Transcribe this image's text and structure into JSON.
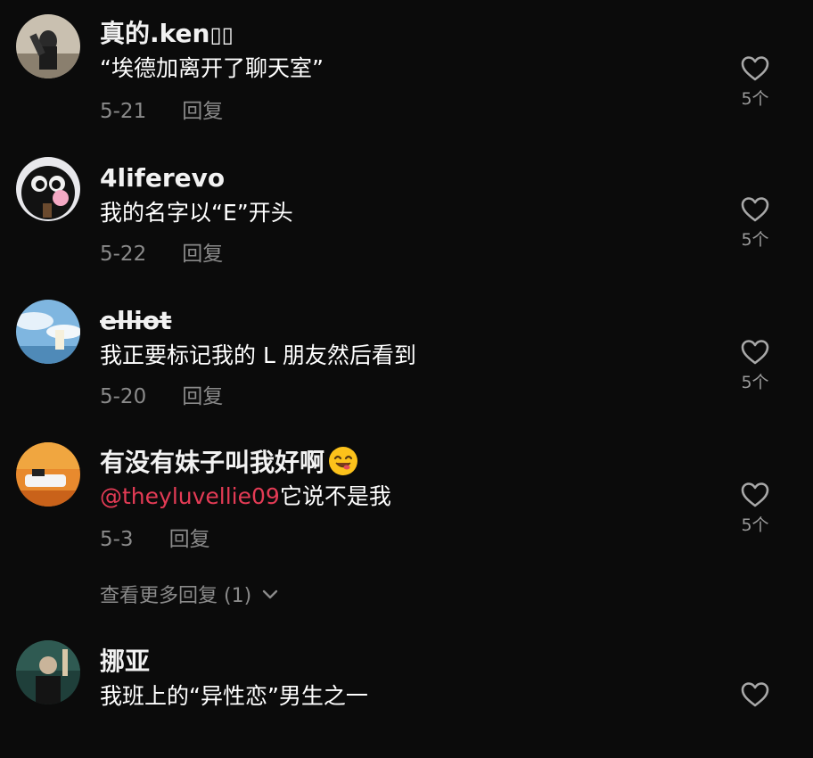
{
  "comments": [
    {
      "username": "真的.ken",
      "username_suffix": "▯▯",
      "text": "“埃德加离开了聊天室”",
      "date": "5-21",
      "reply_label": "回复",
      "likes": "5个"
    },
    {
      "username": "4liferevo",
      "text": "我的名字以“E”开头",
      "date": "5-22",
      "reply_label": "回复",
      "likes": "5个"
    },
    {
      "username": "elliot",
      "text": "我正要标记我的 L 朋友然后看到",
      "date": "5-20",
      "reply_label": "回复",
      "likes": "5个"
    },
    {
      "username": "有没有妹子叫我好啊",
      "emoji_icon": "smiling-face-emoji",
      "mention": "@theyluvellie09",
      "text": "它说不是我",
      "date": "5-3",
      "reply_label": "回复",
      "likes": "5个",
      "view_more": "查看更多回复 (1)"
    },
    {
      "username": "挪亚",
      "text": "我班上的“异性恋”男生之一"
    }
  ],
  "colors": {
    "background": "#0b0b0b",
    "mention": "#e33b55",
    "meta": "#8a8a8a"
  }
}
